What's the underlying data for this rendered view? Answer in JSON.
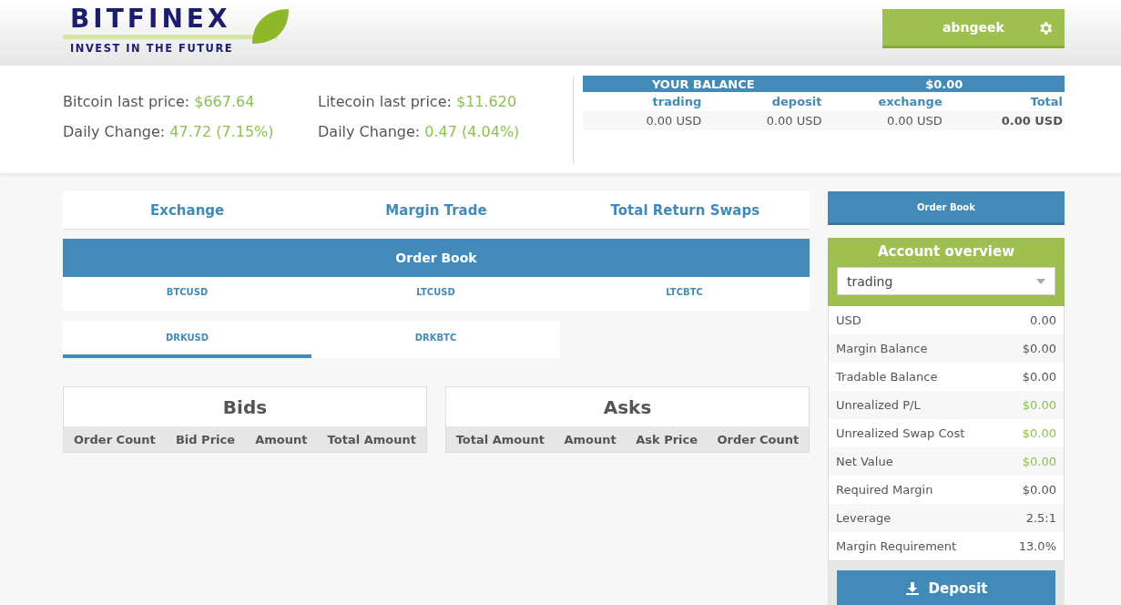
{
  "header": {
    "logo": {
      "name": "BITFINEX",
      "tagline": "INVEST IN THE FUTURE"
    },
    "user_button": "abngeek"
  },
  "prices": [
    {
      "label": "Bitcoin last price:",
      "price": "$667.64",
      "change_label": "Daily Change:",
      "change": "47.72 (7.15%)"
    },
    {
      "label": "Litecoin last price:",
      "price": "$11.620",
      "change_label": "Daily Change:",
      "change": "0.47 (4.04%)"
    }
  ],
  "balance": {
    "title": "YOUR BALANCE",
    "amount": "$0.00",
    "columns": [
      "trading",
      "deposit",
      "exchange",
      "Total"
    ],
    "values": [
      "0.00 USD",
      "0.00 USD",
      "0.00 USD",
      "0.00 USD"
    ]
  },
  "market_tabs": [
    "Exchange",
    "Margin Trade",
    "Total Return Swaps"
  ],
  "order_book": {
    "title": "Order Book",
    "pairs": [
      [
        {
          "label": "BTCUSD",
          "selected": false
        },
        {
          "label": "LTCUSD",
          "selected": false
        },
        {
          "label": "LTCBTC",
          "selected": false
        }
      ],
      [
        {
          "label": "DRKUSD",
          "selected": true
        },
        {
          "label": "DRKBTC",
          "selected": false
        }
      ]
    ],
    "bids": {
      "title": "Bids",
      "columns": [
        "Order Count",
        "Bid Price",
        "Amount",
        "Total Amount"
      ]
    },
    "asks": {
      "title": "Asks",
      "columns": [
        "Total Amount",
        "Amount",
        "Ask Price",
        "Order Count"
      ]
    }
  },
  "sidebar": {
    "order_book_button": "Order Book",
    "account_overview": {
      "title": "Account overview",
      "select": "trading",
      "rows": [
        {
          "label": "USD",
          "value": "0.00",
          "color": "#555555"
        },
        {
          "label": "Margin Balance",
          "value": "$0.00",
          "color": "#555555"
        },
        {
          "label": "Tradable Balance",
          "value": "$0.00",
          "color": "#555555"
        },
        {
          "label": "Unrealized P/L",
          "value": "$0.00",
          "color": "#8cc152"
        },
        {
          "label": "Unrealized Swap Cost",
          "value": "$0.00",
          "color": "#8cc152"
        },
        {
          "label": "Net Value",
          "value": "$0.00",
          "color": "#8cc152"
        },
        {
          "label": "Required Margin",
          "value": "$0.00",
          "color": "#555555"
        },
        {
          "label": "Leverage",
          "value": "2.5:1",
          "color": "#555555"
        },
        {
          "label": "Margin Requirement",
          "value": "13.0%",
          "color": "#555555"
        }
      ],
      "deposit_button": "Deposit"
    }
  }
}
